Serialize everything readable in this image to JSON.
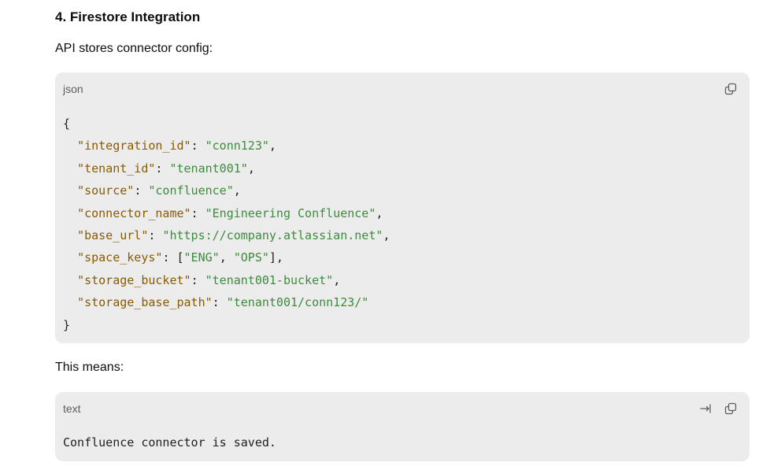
{
  "section": {
    "heading": "4. Firestore Integration",
    "intro": "API stores connector config:",
    "outro": "This means:"
  },
  "json_block": {
    "language": "json",
    "copy_icon": "copy-icon",
    "open_brace": "{",
    "close_brace": "}",
    "entries": [
      {
        "key": "\"integration_id\"",
        "sep": ": ",
        "value": "\"conn123\"",
        "end": ","
      },
      {
        "key": "\"tenant_id\"",
        "sep": ": ",
        "value": "\"tenant001\"",
        "end": ","
      },
      {
        "key": "\"source\"",
        "sep": ": ",
        "value": "\"confluence\"",
        "end": ","
      },
      {
        "key": "\"connector_name\"",
        "sep": ": ",
        "value": "\"Engineering Confluence\"",
        "end": ","
      },
      {
        "key": "\"base_url\"",
        "sep": ": ",
        "value": "\"https://company.atlassian.net\"",
        "end": ","
      },
      {
        "key": "\"space_keys\"",
        "sep": ": [",
        "value": "\"ENG\"",
        "mid": ", ",
        "value2": "\"OPS\"",
        "end": "],"
      },
      {
        "key": "\"storage_bucket\"",
        "sep": ": ",
        "value": "\"tenant001-bucket\"",
        "end": ","
      },
      {
        "key": "\"storage_base_path\"",
        "sep": ": ",
        "value": "\"tenant001/conn123/\"",
        "end": ""
      }
    ]
  },
  "text_block": {
    "language": "text",
    "wrap_icon": "wrap-icon",
    "copy_icon": "copy-icon",
    "content": "Confluence connector is saved."
  },
  "colors": {
    "code_bg": "#ececec",
    "json_key": "#8a5a00",
    "json_string": "#3d8b3d"
  }
}
